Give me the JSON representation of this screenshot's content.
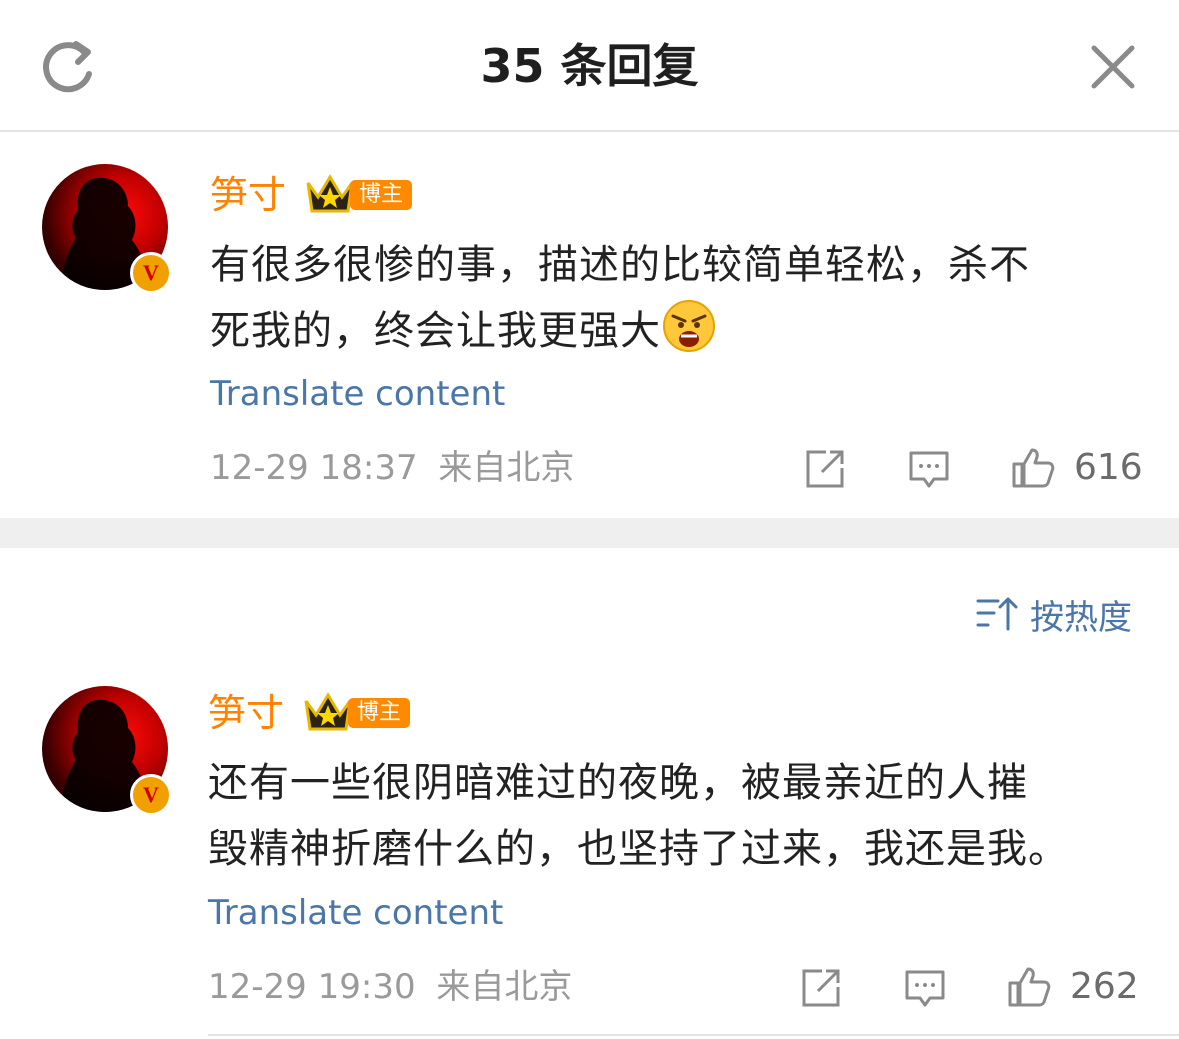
{
  "header": {
    "title": "35 条回复"
  },
  "comments": [
    {
      "username": "笋寸",
      "tag": "博主",
      "text_line1": "有很多很惨的事，描述的比较简单轻松，杀不",
      "text_line2": "死我的，终会让我更强大",
      "translate": "Translate content",
      "time": "12-29 18:37",
      "location": "来自北京",
      "likes": "616"
    },
    {
      "username": "笋寸",
      "tag": "博主",
      "text_line1": "还有一些很阴暗难过的夜晚，被最亲近的人摧",
      "text_line2": "毁精神折磨什么的，也坚持了过来，我还是我。",
      "translate": "Translate content",
      "time": "12-29 19:30",
      "location": "来自北京",
      "likes": "262"
    }
  ],
  "sort": {
    "label": "按热度"
  },
  "colors": {
    "username": "#ff8200",
    "link": "#4a76a8",
    "meta": "#9a9a9a",
    "divider": "#efefef"
  }
}
